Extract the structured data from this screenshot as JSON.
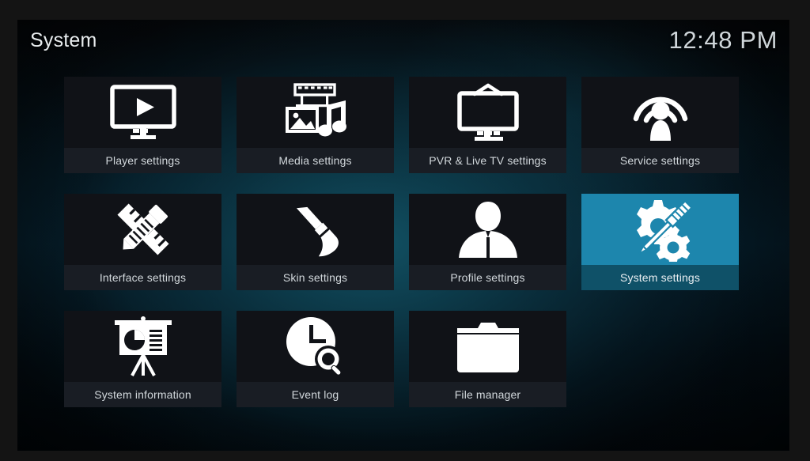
{
  "header": {
    "title": "System",
    "clock": "12:48 PM"
  },
  "theme": {
    "accent": "#1d86ad",
    "accent_label": "#0f5168",
    "tile_bg": "#101318",
    "tile_label_bg": "#191d24",
    "text": "#d2d8dc",
    "letterbox": "#141414"
  },
  "grid": {
    "columns": 4,
    "tiles": [
      {
        "id": "player-settings",
        "label": "Player settings",
        "icon": "monitor-play-icon",
        "selected": false
      },
      {
        "id": "media-settings",
        "label": "Media settings",
        "icon": "film-photo-music-icon",
        "selected": false
      },
      {
        "id": "pvr-live-tv-settings",
        "label": "PVR & Live TV settings",
        "icon": "tv-antenna-icon",
        "selected": false
      },
      {
        "id": "service-settings",
        "label": "Service settings",
        "icon": "broadcast-person-icon",
        "selected": false
      },
      {
        "id": "interface-settings",
        "label": "Interface settings",
        "icon": "pencil-ruler-icon",
        "selected": false
      },
      {
        "id": "skin-settings",
        "label": "Skin settings",
        "icon": "paintbrush-icon",
        "selected": false
      },
      {
        "id": "profile-settings",
        "label": "Profile settings",
        "icon": "user-silhouette-icon",
        "selected": false
      },
      {
        "id": "system-settings",
        "label": "System settings",
        "icon": "gear-screwdriver-icon",
        "selected": true
      },
      {
        "id": "system-information",
        "label": "System information",
        "icon": "presentation-chart-icon",
        "selected": false
      },
      {
        "id": "event-log",
        "label": "Event log",
        "icon": "clock-search-icon",
        "selected": false
      },
      {
        "id": "file-manager",
        "label": "File manager",
        "icon": "folder-icon",
        "selected": false
      }
    ]
  }
}
